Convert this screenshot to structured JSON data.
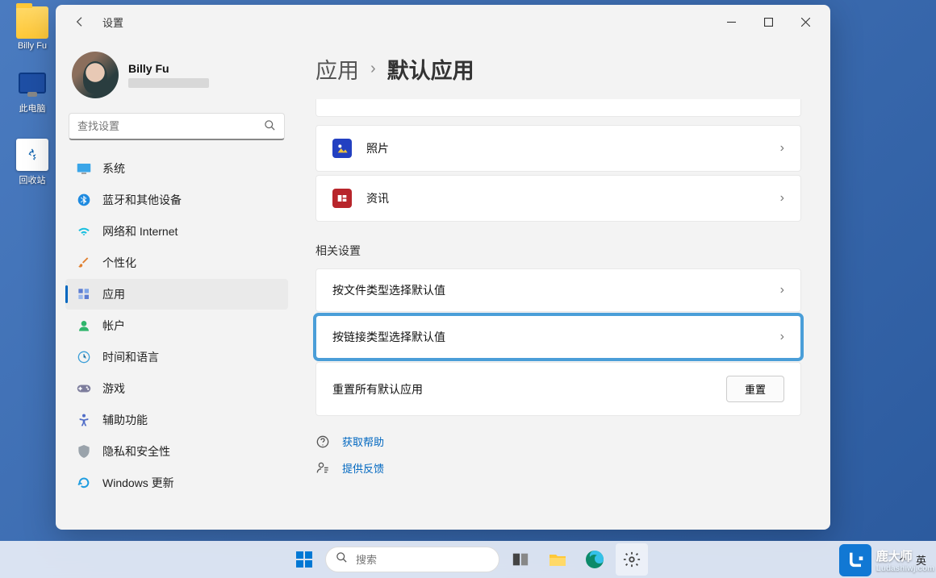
{
  "desktop": {
    "icons": [
      {
        "name": "folder",
        "label": "Billy Fu"
      },
      {
        "name": "this-pc",
        "label": "此电脑"
      },
      {
        "name": "recycle-bin",
        "label": "回收站"
      }
    ]
  },
  "window": {
    "title": "设置",
    "user": {
      "name": "Billy Fu"
    },
    "search": {
      "placeholder": "查找设置"
    },
    "nav": [
      {
        "key": "system",
        "label": "系统",
        "icon": "display-icon",
        "color": "#3aa5e8"
      },
      {
        "key": "bluetooth",
        "label": "蓝牙和其他设备",
        "icon": "bluetooth-icon",
        "color": "#1e8ae0"
      },
      {
        "key": "network",
        "label": "网络和 Internet",
        "icon": "wifi-icon",
        "color": "#18bfdf"
      },
      {
        "key": "personalize",
        "label": "个性化",
        "icon": "brush-icon",
        "color": "#e07f2e"
      },
      {
        "key": "apps",
        "label": "应用",
        "icon": "apps-icon",
        "color": "#5b7cd1",
        "selected": true
      },
      {
        "key": "accounts",
        "label": "帐户",
        "icon": "person-icon",
        "color": "#2fb56b"
      },
      {
        "key": "time",
        "label": "时间和语言",
        "icon": "globe-clock-icon",
        "color": "#3c9fd8"
      },
      {
        "key": "gaming",
        "label": "游戏",
        "icon": "gamepad-icon",
        "color": "#7d7d9c"
      },
      {
        "key": "accessibility",
        "label": "辅助功能",
        "icon": "accessibility-icon",
        "color": "#4f6cc7"
      },
      {
        "key": "privacy",
        "label": "隐私和安全性",
        "icon": "shield-icon",
        "color": "#9aa3ab"
      },
      {
        "key": "update",
        "label": "Windows 更新",
        "icon": "windows-update-icon",
        "color": "#1f9de0"
      }
    ],
    "breadcrumb": {
      "parent": "应用",
      "current": "默认应用"
    },
    "apps": [
      {
        "key": "photos",
        "label": "照片",
        "color": "#2340c1"
      },
      {
        "key": "news",
        "label": "资讯",
        "color": "#b8252b"
      }
    ],
    "related": {
      "title": "相关设置",
      "items": [
        {
          "key": "by-filetype",
          "label": "按文件类型选择默认值"
        },
        {
          "key": "by-linktype",
          "label": "按链接类型选择默认值",
          "highlight": true
        },
        {
          "key": "reset",
          "label": "重置所有默认应用",
          "button": "重置"
        }
      ]
    },
    "links": {
      "help": "获取帮助",
      "feedback": "提供反馈"
    }
  },
  "taskbar": {
    "search_placeholder": "搜索",
    "tray": {
      "lang": "英"
    }
  },
  "watermark": {
    "brand": "鹿大师",
    "url": "Ludashiwj.com"
  }
}
